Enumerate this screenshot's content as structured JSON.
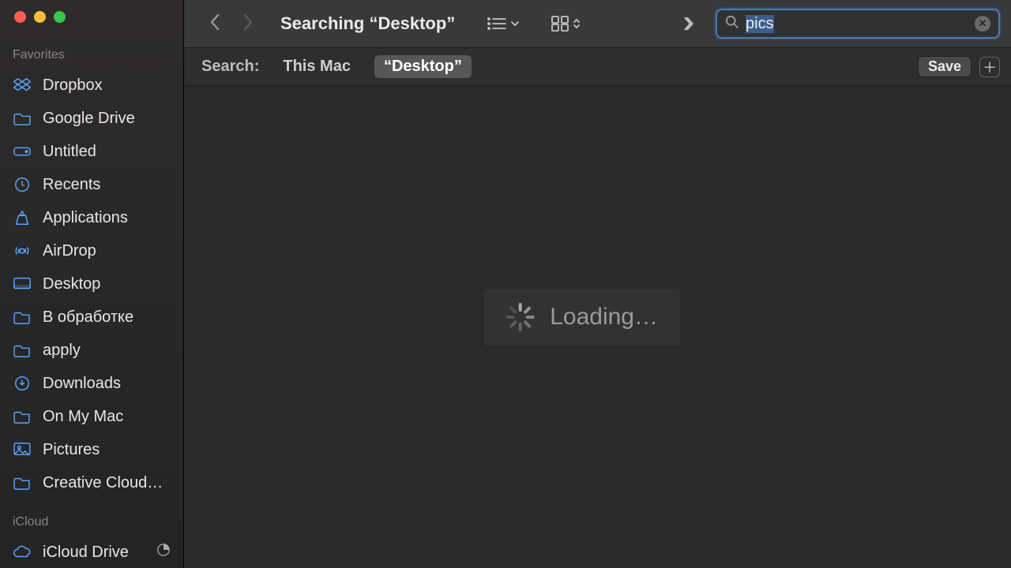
{
  "window": {
    "title": "Searching “Desktop”"
  },
  "search": {
    "value": "pics"
  },
  "scopebar": {
    "label": "Search:",
    "options": [
      {
        "label": "This Mac",
        "active": false
      },
      {
        "label": "“Desktop”",
        "active": true
      }
    ],
    "save_label": "Save"
  },
  "loading": {
    "text": "Loading…"
  },
  "sidebar": {
    "sections": [
      {
        "title": "Favorites",
        "items": [
          {
            "icon": "dropbox",
            "label": "Dropbox"
          },
          {
            "icon": "folder",
            "label": "Google Drive"
          },
          {
            "icon": "disk",
            "label": "Untitled"
          },
          {
            "icon": "clock",
            "label": "Recents"
          },
          {
            "icon": "apps",
            "label": "Applications"
          },
          {
            "icon": "airdrop",
            "label": "AirDrop"
          },
          {
            "icon": "desktop",
            "label": "Desktop"
          },
          {
            "icon": "folder",
            "label": "В обработке"
          },
          {
            "icon": "folder",
            "label": "apply"
          },
          {
            "icon": "download",
            "label": "Downloads"
          },
          {
            "icon": "folder",
            "label": "On My Mac"
          },
          {
            "icon": "pictures",
            "label": "Pictures"
          },
          {
            "icon": "folder",
            "label": "Creative Cloud…"
          }
        ]
      },
      {
        "title": "iCloud",
        "items": [
          {
            "icon": "icloud",
            "label": "iCloud Drive",
            "trailing": "pie"
          }
        ]
      }
    ]
  }
}
